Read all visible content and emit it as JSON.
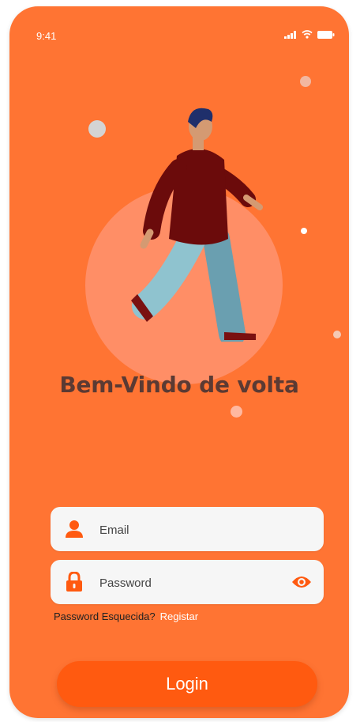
{
  "status_bar": {
    "time": "9:41",
    "icons": [
      "signal-icon",
      "wifi-icon",
      "battery-icon"
    ]
  },
  "welcome": {
    "title": "Bem-Vindo de volta"
  },
  "form": {
    "email": {
      "placeholder": "Email",
      "value": "",
      "icon": "user-icon"
    },
    "password": {
      "placeholder": "Password",
      "value": "",
      "icon": "lock-icon",
      "toggle_icon": "eye-icon"
    }
  },
  "links": {
    "forgot_password": "Password Esquecida?",
    "register": "Registar"
  },
  "login_button": {
    "label": "Login"
  },
  "colors": {
    "background": "#ff7433",
    "accent": "#ff5a10",
    "field_bg": "#f6f6f6",
    "title_text": "#5b3a33"
  }
}
